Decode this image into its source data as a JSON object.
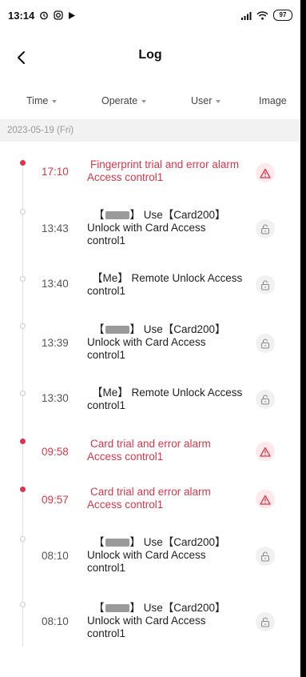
{
  "status_bar": {
    "time": "13:14",
    "battery": "97"
  },
  "header": {
    "title": "Log"
  },
  "filters": {
    "time": "Time",
    "operate": "Operate",
    "user": "User",
    "image": "Image"
  },
  "date": "2023-05-19 (Fri)",
  "colors": {
    "alarm": "#d8374a",
    "normal_text": "#222222",
    "time_gray": "#555555"
  },
  "entries": [
    {
      "time": "17:10",
      "type": "alarm",
      "line1": "Fingerprint trial and error alarm",
      "line2": "Access control1",
      "icon": "warning-icon"
    },
    {
      "time": "13:43",
      "type": "normal",
      "line1a": "【",
      "line1b": "】 Use【Card200】",
      "line2": "Unlock with Card Access",
      "line3": "control1",
      "icon": "unlock-icon"
    },
    {
      "time": "13:40",
      "type": "normal",
      "line1": "【Me】 Remote Unlock Access",
      "line2": "control1",
      "icon": "unlock-icon"
    },
    {
      "time": "13:39",
      "type": "normal",
      "line1a": "【",
      "line1b": "】 Use【Card200】",
      "line2": "Unlock with Card Access",
      "line3": "control1",
      "icon": "unlock-icon"
    },
    {
      "time": "13:30",
      "type": "normal",
      "line1": "【Me】 Remote Unlock Access",
      "line2": "control1",
      "icon": "unlock-icon"
    },
    {
      "time": "09:58",
      "type": "alarm",
      "line1": "Card trial and error alarm",
      "line2": "Access control1",
      "icon": "warning-icon"
    },
    {
      "time": "09:57",
      "type": "alarm",
      "line1": "Card trial and error alarm",
      "line2": "Access control1",
      "icon": "warning-icon"
    },
    {
      "time": "08:10",
      "type": "normal",
      "line1a": "【",
      "line1b": "】 Use【Card200】",
      "line2": "Unlock with Card Access",
      "line3": "control1",
      "icon": "unlock-icon"
    },
    {
      "time": "08:10",
      "type": "normal",
      "line1a": "【",
      "line1b": "】 Use【Card200】",
      "line2": "Unlock with Card Access",
      "line3": "control1",
      "icon": "unlock-icon"
    }
  ]
}
